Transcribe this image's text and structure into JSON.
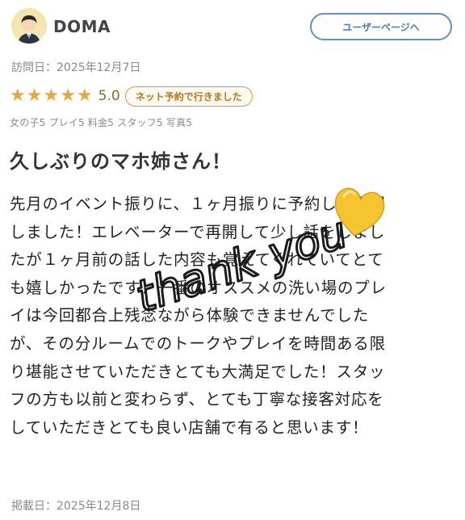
{
  "header": {
    "username": "DOMA",
    "user_page_button": "ユーザーページへ"
  },
  "review": {
    "visit_date": "訪問日：2025年12月7日",
    "star_count": 5,
    "score": "5.0",
    "net_badge": "ネット予約で行きました",
    "ratings_detail": "女の子5 プレイ5 料金5 スタッフ5 写真5",
    "title": "久しぶりのマホ姉さん！",
    "body_lines": [
      "先月のイベント振りに、１ヶ月振りに予約して再開",
      "しました！エレベーターで再開して少し話をしまし",
      "たが１ヶ月前の話した内容も覚えてくれていてとて",
      "も嬉しかったです！一番のオススメの洗い場のプレ",
      "イは今回都合上残念ながら体験できませんでした",
      "が、その分ルームでのトークやプレイを時間ある限",
      "り堪能させていただきとても大満足でした！スタッ",
      "フの方も以前と変わらず、とても丁寧な接客対応を",
      "していただきとても良い店舗で有ると思います！"
    ],
    "post_date": "掲載日：2025年12月8日"
  },
  "overlay": {
    "handwriting": "thank you",
    "heart_icon": "yellow-heart-icon"
  },
  "colors": {
    "star": "#e6a73c",
    "badge_border": "#d29a48",
    "button_border": "#5f8ec8",
    "heart": "#f5c531"
  }
}
